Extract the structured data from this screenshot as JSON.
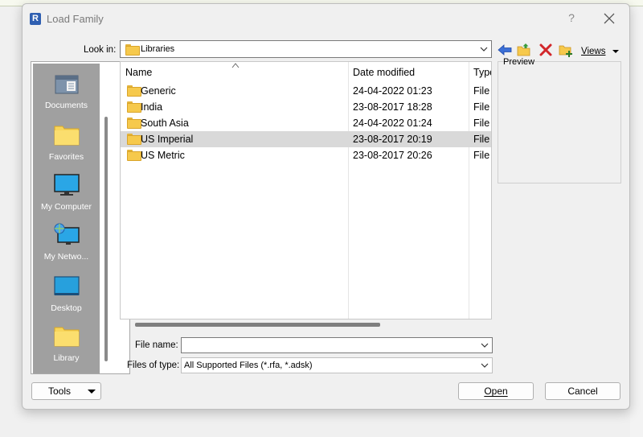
{
  "window": {
    "title": "Load Family",
    "app_icon_letter": "R",
    "help": "?",
    "close_icon": "close-icon"
  },
  "lookin": {
    "label": "Look in:",
    "value": "Libraries"
  },
  "toolbar": {
    "back_icon": "back-arrow-icon",
    "up_icon": "up-folder-icon",
    "delete_icon": "delete-icon",
    "new_folder_icon": "new-folder-icon",
    "views_label": "Views"
  },
  "places": [
    {
      "label": "Documents",
      "icon": "documents-icon"
    },
    {
      "label": "Favorites",
      "icon": "favorites-folder-icon"
    },
    {
      "label": "My Computer",
      "icon": "computer-icon"
    },
    {
      "label": "My Netwo...",
      "icon": "network-icon"
    },
    {
      "label": "Desktop",
      "icon": "desktop-icon"
    },
    {
      "label": "Library",
      "icon": "library-folder-icon"
    }
  ],
  "filelist": {
    "columns": [
      "Name",
      "Date modified",
      "Type"
    ],
    "rows": [
      {
        "name": "Generic",
        "date": "24-04-2022 01:23",
        "type": "File",
        "selected": false
      },
      {
        "name": "India",
        "date": "23-08-2017 18:28",
        "type": "File",
        "selected": false
      },
      {
        "name": "South Asia",
        "date": "24-04-2022 01:24",
        "type": "File",
        "selected": false
      },
      {
        "name": "US Imperial",
        "date": "23-08-2017 20:19",
        "type": "File",
        "selected": true
      },
      {
        "name": "US Metric",
        "date": "23-08-2017 20:26",
        "type": "File",
        "selected": false
      }
    ]
  },
  "preview": {
    "label": "Preview"
  },
  "filename": {
    "label": "File name:",
    "value": ""
  },
  "filetype": {
    "label": "Files of type:",
    "value": "All Supported Files  (*.rfa, *.adsk)"
  },
  "buttons": {
    "tools": "Tools",
    "open": "Open",
    "cancel": "Cancel"
  }
}
